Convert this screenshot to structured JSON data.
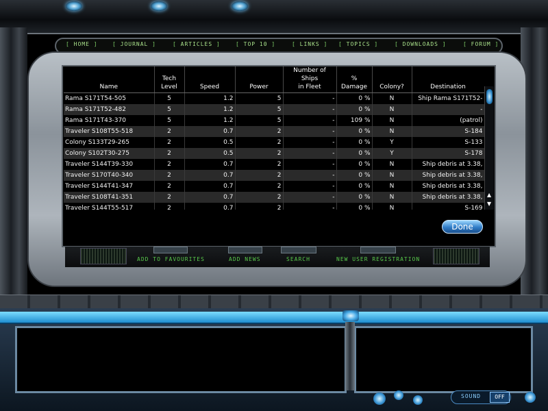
{
  "nav": {
    "items": [
      "HOME",
      "JOURNAL",
      "ARTICLES",
      "TOP 10",
      "LINKS",
      "TOPICS",
      "DOWNLOADS",
      "FORUM"
    ]
  },
  "table": {
    "headers": [
      "Name",
      "Tech\nLevel",
      "Speed",
      "Power",
      "Number of Ships\nin Fleet",
      "%\nDamage",
      "Colony?",
      "Destination"
    ],
    "rows": [
      [
        "Rama  S171T54-505",
        "5",
        "1.2",
        "5",
        "-",
        "0 %",
        "N",
        "Ship Rama  S171T52-"
      ],
      [
        "Rama  S171T52-482",
        "5",
        "1.2",
        "5",
        "-",
        "0 %",
        "N",
        "-"
      ],
      [
        "Rama  S171T43-370",
        "5",
        "1.2",
        "5",
        "-",
        "109 %",
        "N",
        "(patrol)"
      ],
      [
        "Traveler  S108T55-518",
        "2",
        "0.7",
        "2",
        "-",
        "0 %",
        "N",
        "S-184"
      ],
      [
        "Colony  S133T29-265",
        "2",
        "0.5",
        "2",
        "-",
        "0 %",
        "Y",
        "S-133"
      ],
      [
        "Colony  S102T30-275",
        "2",
        "0.5",
        "2",
        "-",
        "0 %",
        "Y",
        "S-178"
      ],
      [
        "Traveler  S144T39-330",
        "2",
        "0.7",
        "2",
        "-",
        "0 %",
        "N",
        "Ship debris at 3.38,"
      ],
      [
        "Traveler  S170T40-340",
        "2",
        "0.7",
        "2",
        "-",
        "0 %",
        "N",
        "Ship debris at 3.38,"
      ],
      [
        "Traveler  S144T41-347",
        "2",
        "0.7",
        "2",
        "-",
        "0 %",
        "N",
        "Ship debris at 3.38,"
      ],
      [
        "Traveler  S108T41-351",
        "2",
        "0.7",
        "2",
        "-",
        "0 %",
        "N",
        "Ship debris at 3.38,"
      ],
      [
        "Traveler  S144T55-517",
        "2",
        "0.7",
        "2",
        "-",
        "0 %",
        "N",
        "S-169"
      ]
    ]
  },
  "done_label": "Done",
  "links": [
    "ADD TO FAVOURITES",
    "ADD NEWS",
    "SEARCH",
    "NEW USER REGISTRATION"
  ],
  "sound": {
    "label": "SOUND",
    "state": "OFF"
  },
  "scroll": {
    "up": "▲",
    "down": "▼"
  }
}
